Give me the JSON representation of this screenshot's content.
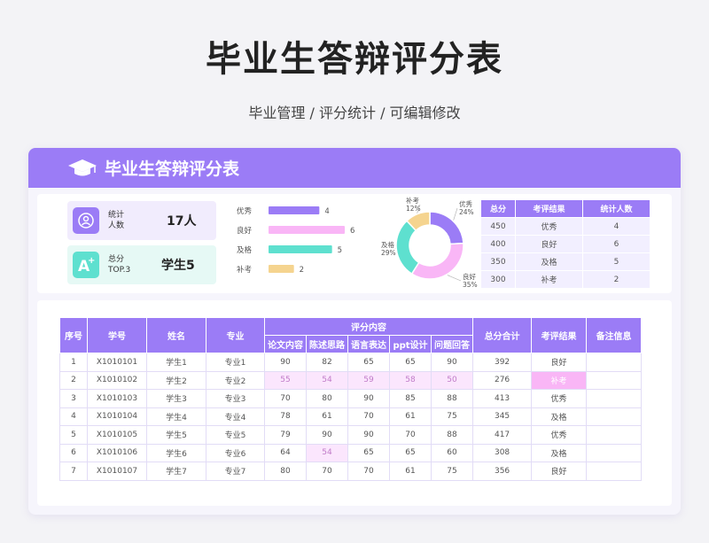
{
  "page": {
    "title": "毕业生答辩评分表",
    "subtitle": "毕业管理 / 评分统计 / 可编辑修改"
  },
  "card": {
    "title": "毕业生答辩评分表"
  },
  "stats": {
    "count_label_1": "统计",
    "count_label_2": "人数",
    "count_value": "17人",
    "top_label_1": "总分",
    "top_label_2": "TOP.3",
    "top_value": "学生5"
  },
  "colors": {
    "accent": "#9b7cf6",
    "pink": "#f9b6f6",
    "teal": "#5ee0cf",
    "yellow": "#f5d48f"
  },
  "chart_data": [
    {
      "type": "bar",
      "categories": [
        "优秀",
        "良好",
        "及格",
        "补考"
      ],
      "values": [
        4,
        6,
        5,
        2
      ],
      "colors": [
        "#9b7cf6",
        "#f9b6f6",
        "#5ee0cf",
        "#f5d48f"
      ]
    },
    {
      "type": "pie",
      "categories": [
        "优秀",
        "良好",
        "及格",
        "补考"
      ],
      "values": [
        24,
        35,
        29,
        12
      ],
      "labels": [
        "24%",
        "35%",
        "29%",
        "12%"
      ],
      "colors": [
        "#9b7cf6",
        "#f9b6f6",
        "#5ee0cf",
        "#f5d48f"
      ]
    }
  ],
  "summary": {
    "headers": [
      "总分",
      "考评结果",
      "统计人数"
    ],
    "rows": [
      [
        "450",
        "优秀",
        "4"
      ],
      [
        "400",
        "良好",
        "6"
      ],
      [
        "350",
        "及格",
        "5"
      ],
      [
        "300",
        "补考",
        "2"
      ]
    ]
  },
  "table": {
    "headers": {
      "index": "序号",
      "id": "学号",
      "name": "姓名",
      "major": "专业",
      "group": "评分内容",
      "sub": [
        "论文内容",
        "陈述思路",
        "语言表达",
        "ppt设计",
        "问题回答"
      ],
      "total": "总分合计",
      "result": "考评结果",
      "note": "备注信息"
    },
    "rows": [
      [
        "1",
        "X1010101",
        "学生1",
        "专业1",
        "90",
        "82",
        "65",
        "65",
        "90",
        "392",
        "良好",
        ""
      ],
      [
        "2",
        "X1010102",
        "学生2",
        "专业2",
        "55",
        "54",
        "59",
        "58",
        "50",
        "276",
        "补考",
        ""
      ],
      [
        "3",
        "X1010103",
        "学生3",
        "专业3",
        "70",
        "80",
        "90",
        "85",
        "88",
        "413",
        "优秀",
        ""
      ],
      [
        "4",
        "X1010104",
        "学生4",
        "专业4",
        "78",
        "61",
        "70",
        "61",
        "75",
        "345",
        "及格",
        ""
      ],
      [
        "5",
        "X1010105",
        "学生5",
        "专业5",
        "79",
        "90",
        "90",
        "70",
        "88",
        "417",
        "优秀",
        ""
      ],
      [
        "6",
        "X1010106",
        "学生6",
        "专业6",
        "64",
        "54",
        "65",
        "65",
        "60",
        "308",
        "及格",
        ""
      ],
      [
        "7",
        "X1010107",
        "学生7",
        "专业7",
        "80",
        "70",
        "70",
        "61",
        "75",
        "356",
        "良好",
        ""
      ]
    ]
  }
}
